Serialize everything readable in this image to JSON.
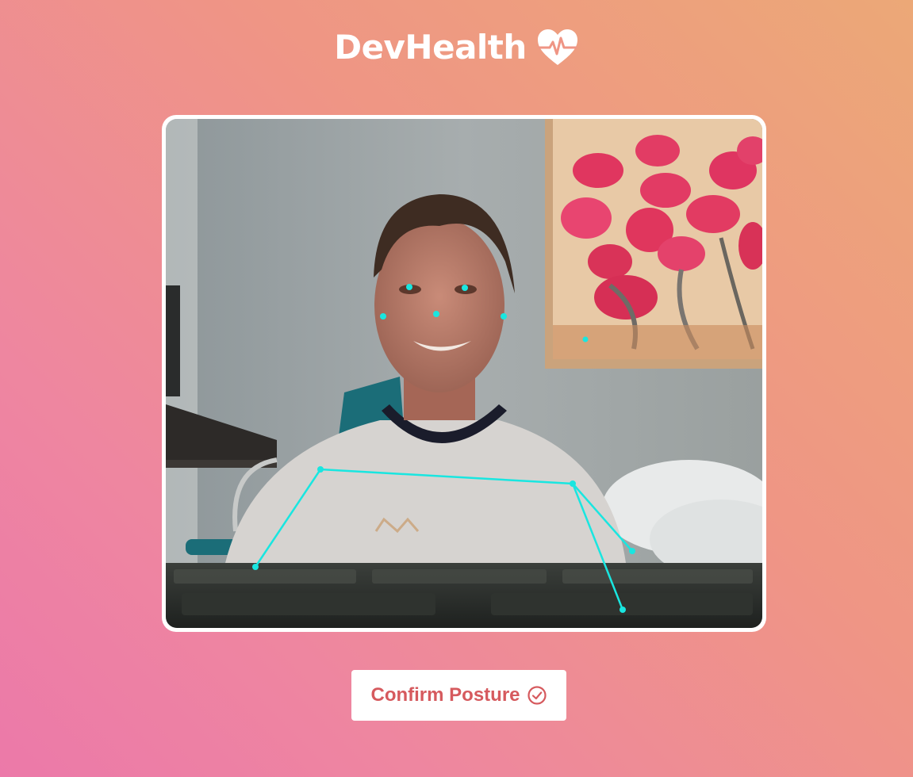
{
  "app": {
    "brand_name": "DevHealth",
    "brand_icon": "heart-pulse-icon"
  },
  "camera": {
    "keypoint_color": "#19e6e0",
    "keypoint_count": 12
  },
  "actions": {
    "confirm_label": "Confirm Posture",
    "confirm_icon": "check-circle-icon",
    "confirm_color": "#d65a5e"
  },
  "colors": {
    "gradient_top_right": "#eca877",
    "gradient_bottom_left": "#ec79a9",
    "accent": "#ffffff"
  }
}
